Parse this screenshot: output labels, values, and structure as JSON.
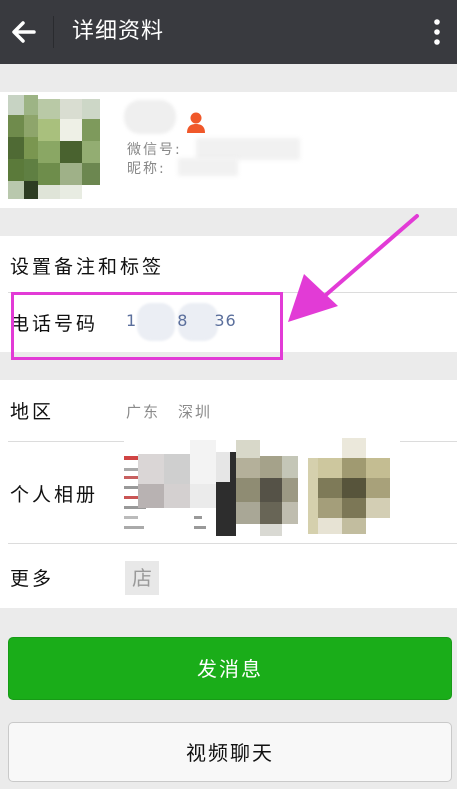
{
  "header": {
    "title": "详细资料",
    "back_icon": "arrow-left-icon",
    "more_icon": "more-vertical-icon"
  },
  "profile": {
    "wechat_id_label": "微信号:",
    "nickname_label": "昵称:",
    "gender_icon": "person-icon",
    "gender_icon_color": "#f0582a"
  },
  "remarks": {
    "label": "设置备注和标签"
  },
  "phone": {
    "label": "电话号码",
    "digits": [
      "1",
      "8",
      "36"
    ]
  },
  "region": {
    "label": "地区",
    "province": "广东",
    "city": "深圳"
  },
  "album": {
    "label": "个人相册",
    "photo_count": 3
  },
  "more": {
    "label": "更多",
    "shop_icon_text": "店"
  },
  "actions": {
    "send_message": "发消息",
    "video_call": "视频聊天"
  },
  "colors": {
    "titlebar": "#393a3f",
    "accent_green": "#1aad19",
    "highlight_magenta": "#e23bd6",
    "phone_text": "#5b6f9c"
  }
}
